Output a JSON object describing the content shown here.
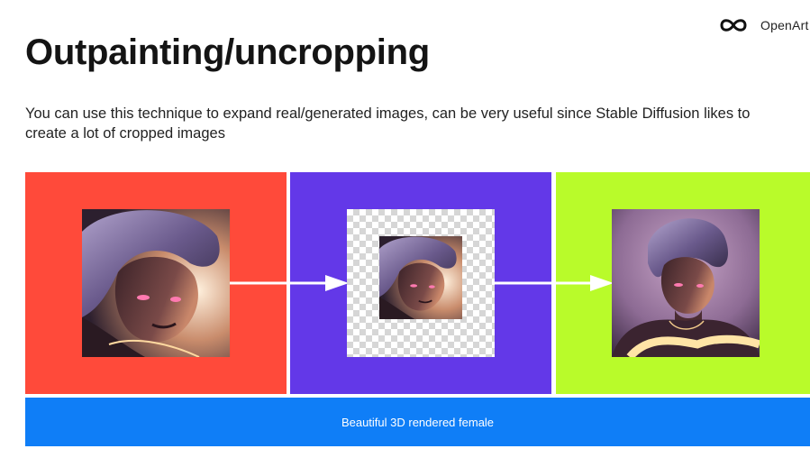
{
  "brand": {
    "name": "OpenArt",
    "logo_icon": "infinity-logo-icon"
  },
  "title": "Outpainting/uncropping",
  "description": {
    "line1": "You can use this technique to expand real/generated images, can be very useful since Stable Diffusion likes to",
    "line2": "create a lot of cropped images"
  },
  "figure": {
    "caption": "Beautiful 3D rendered female",
    "colors": {
      "panel_left": "#ff4a3a",
      "panel_middle": "#6338e8",
      "panel_right": "#b9fb2a",
      "caption_bar": "#0f7ef7",
      "arrow": "#ffffff",
      "transparency_checker": "#d6d6d6"
    },
    "steps": [
      "original-portrait",
      "shrunk-portrait-on-transparent-canvas",
      "outpainted-portrait"
    ]
  }
}
